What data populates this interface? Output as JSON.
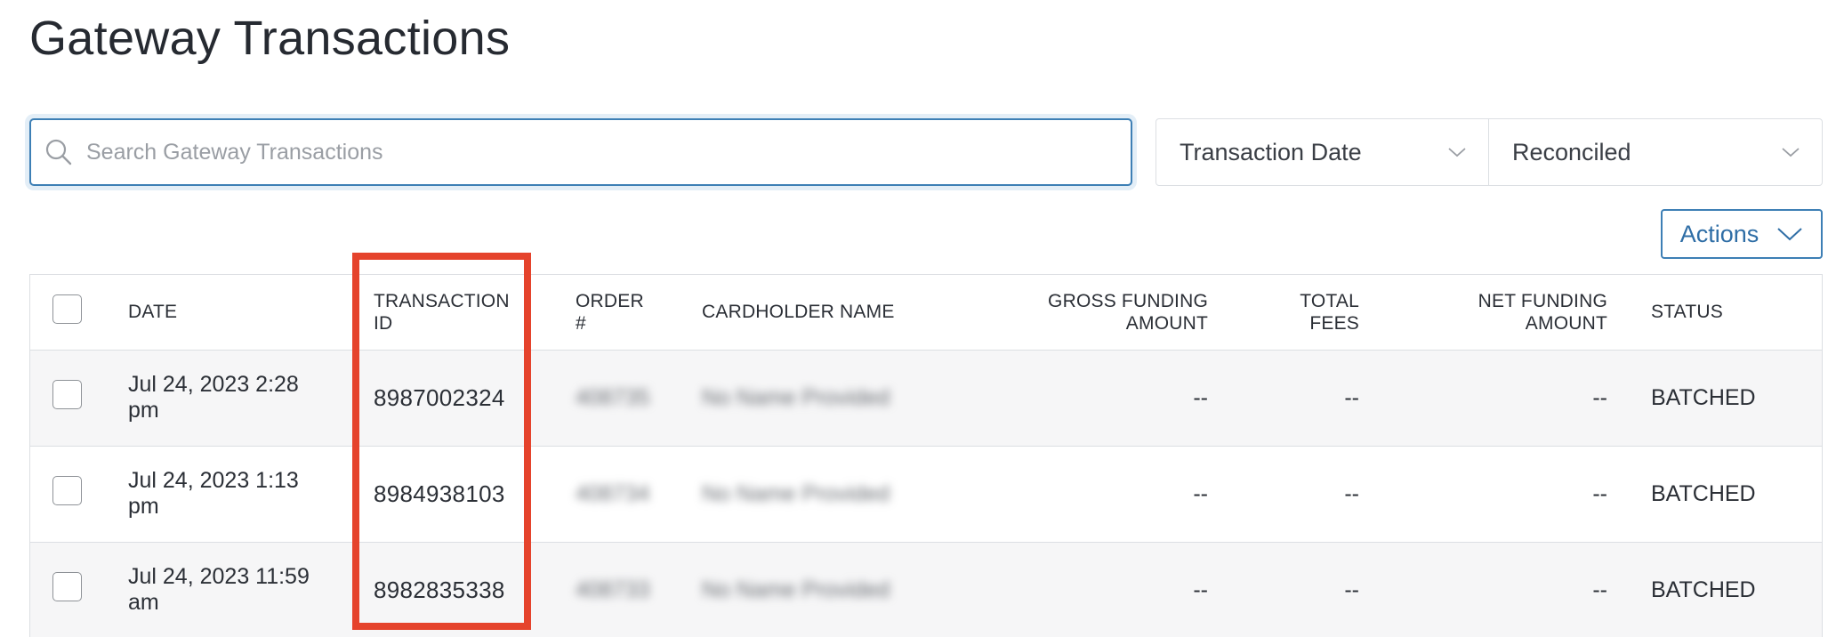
{
  "page": {
    "title": "Gateway Transactions"
  },
  "search": {
    "placeholder": "Search Gateway Transactions"
  },
  "filters": {
    "date_label": "Transaction Date",
    "reconciled_label": "Reconciled"
  },
  "toolbar": {
    "actions_label": "Actions"
  },
  "table": {
    "headers": {
      "date": "DATE",
      "transaction_id_1": "TRANSACTION",
      "transaction_id_2": "ID",
      "order_1": "ORDER",
      "order_2": "#",
      "cardholder": "CARDHOLDER NAME",
      "gross_1": "GROSS FUNDING",
      "gross_2": "AMOUNT",
      "fees_1": "TOTAL",
      "fees_2": "FEES",
      "net_1": "NET FUNDING",
      "net_2": "AMOUNT",
      "status": "STATUS"
    },
    "rows": [
      {
        "date_1": "Jul 24, 2023 2:28",
        "date_2": "pm",
        "transaction_id": "8987002324",
        "order": "408735",
        "cardholder": "No Name Provided",
        "gross": "--",
        "fees": "--",
        "net": "--",
        "status": "BATCHED"
      },
      {
        "date_1": "Jul 24, 2023 1:13",
        "date_2": "pm",
        "transaction_id": "8984938103",
        "order": "408734",
        "cardholder": "No Name Provided",
        "gross": "--",
        "fees": "--",
        "net": "--",
        "status": "BATCHED"
      },
      {
        "date_1": "Jul 24, 2023 11:59",
        "date_2": "am",
        "transaction_id": "8982835338",
        "order": "408733",
        "cardholder": "No Name Provided",
        "gross": "--",
        "fees": "--",
        "net": "--",
        "status": "BATCHED"
      }
    ]
  },
  "colors": {
    "accent": "#3d7fb5",
    "highlight": "#e5432c",
    "row_alt": "#f6f6f7"
  },
  "icons": {
    "search": "search-icon",
    "chevron": "chevron-down-icon"
  }
}
